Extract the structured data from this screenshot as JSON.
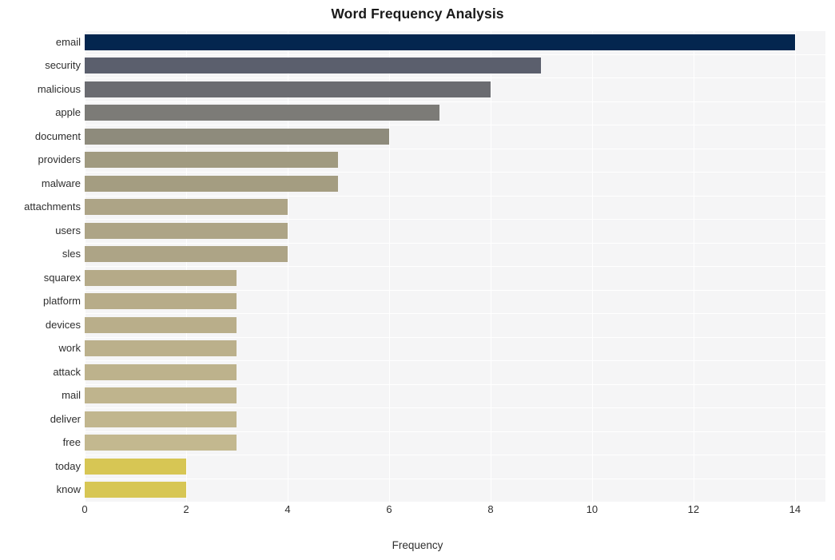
{
  "chart_data": {
    "type": "bar",
    "orientation": "horizontal",
    "title": "Word Frequency Analysis",
    "xlabel": "Frequency",
    "ylabel": "",
    "xlim": [
      0,
      14.6
    ],
    "ylim": [
      0,
      20
    ],
    "grid": true,
    "legend": false,
    "xticks": [
      0,
      2,
      4,
      6,
      8,
      10,
      12,
      14
    ],
    "xtick_labels": [
      "0",
      "2",
      "4",
      "6",
      "8",
      "10",
      "12",
      "14"
    ],
    "categories": [
      "email",
      "security",
      "malicious",
      "apple",
      "document",
      "providers",
      "malware",
      "attachments",
      "users",
      "sles",
      "squarex",
      "platform",
      "devices",
      "work",
      "attack",
      "mail",
      "deliver",
      "free",
      "today",
      "know"
    ],
    "values": [
      14,
      9,
      8,
      7,
      6,
      5,
      5,
      4,
      4,
      4,
      3,
      3,
      3,
      3,
      3,
      3,
      3,
      3,
      2,
      2
    ],
    "bar_colors": [
      "#04264f",
      "#5b5f6d",
      "#6b6c71",
      "#7c7b77",
      "#8e8b7c",
      "#a09a80",
      "#a49d81",
      "#ada486",
      "#ada486",
      "#ada486",
      "#b5aa88",
      "#b7ac89",
      "#b9ae8a",
      "#bbb08b",
      "#bdb28c",
      "#bfb48d",
      "#c1b68e",
      "#c3b88f",
      "#d7c654",
      "#d7c654"
    ],
    "plot_background": "#f5f5f6",
    "grid_color": "#ffffff",
    "figure_background": "#ffffff",
    "text_color": "#2e2e2e",
    "title_color": "#1a1a1a"
  }
}
